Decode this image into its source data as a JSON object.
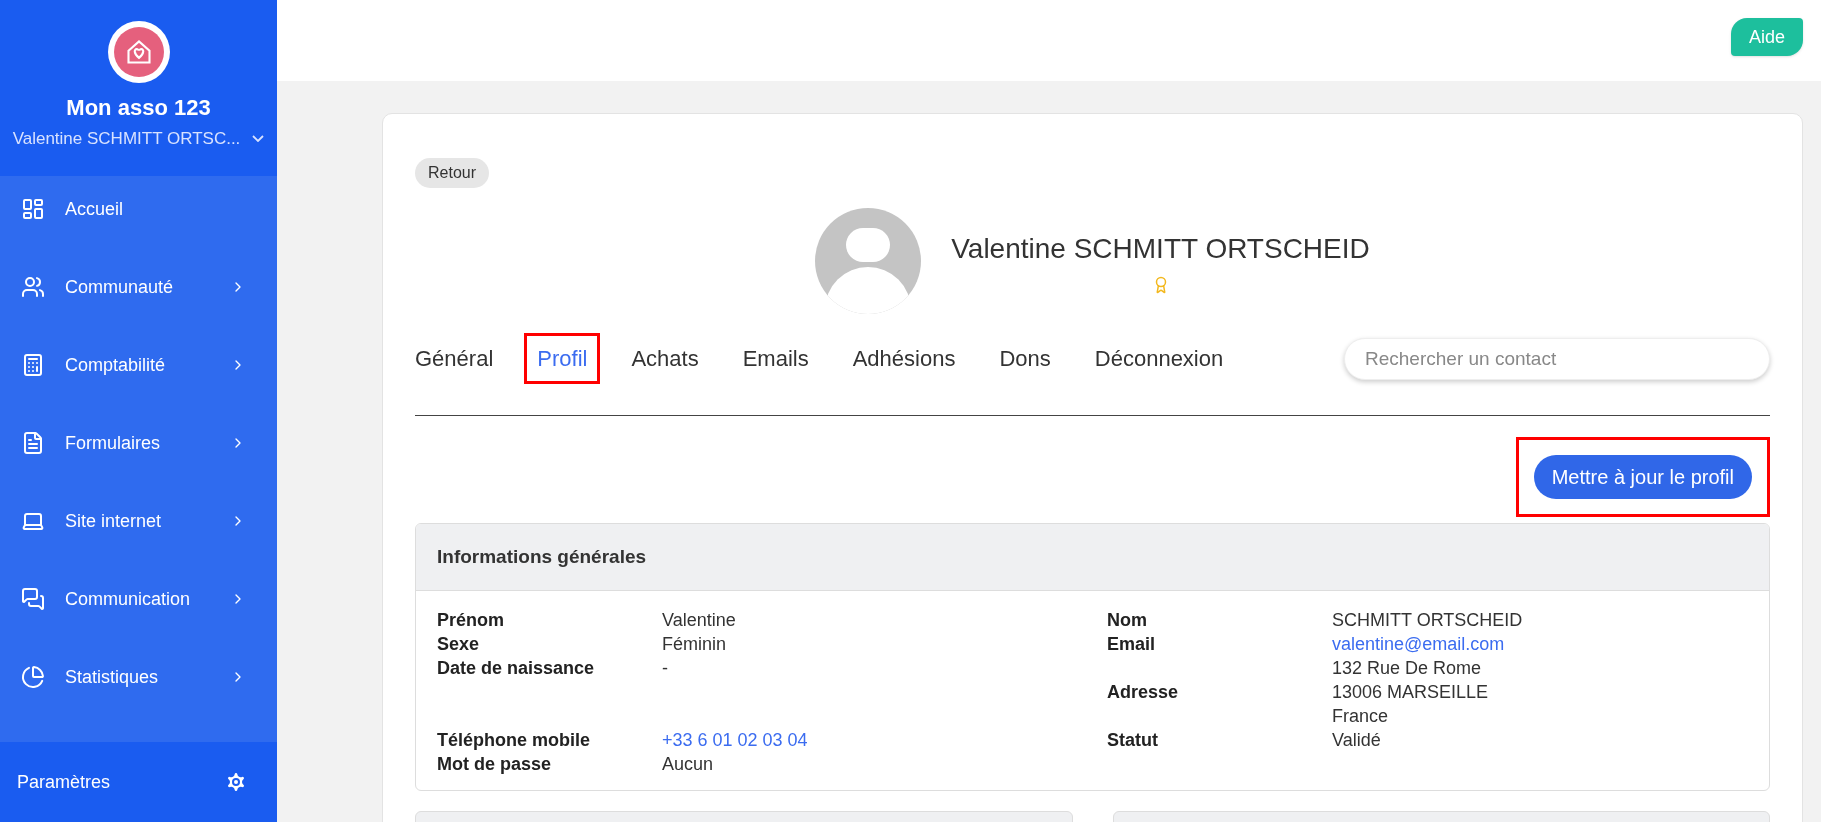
{
  "sidebar": {
    "org_name": "Mon asso 123",
    "user_name": "Valentine SCHMITT ORTSC...",
    "items": [
      {
        "label": "Accueil",
        "has_submenu": false
      },
      {
        "label": "Communauté",
        "has_submenu": true
      },
      {
        "label": "Comptabilité",
        "has_submenu": true
      },
      {
        "label": "Formulaires",
        "has_submenu": true
      },
      {
        "label": "Site internet",
        "has_submenu": true
      },
      {
        "label": "Communication",
        "has_submenu": true
      },
      {
        "label": "Statistiques",
        "has_submenu": true
      }
    ],
    "settings_label": "Paramètres"
  },
  "help_button": "Aide",
  "back_button": "Retour",
  "contact": {
    "name": "Valentine SCHMITT ORTSCHEID"
  },
  "tabs": [
    {
      "label": "Général",
      "selected": false,
      "highlighted": false
    },
    {
      "label": "Profil",
      "selected": true,
      "highlighted": true
    },
    {
      "label": "Achats",
      "selected": false,
      "highlighted": false
    },
    {
      "label": "Emails",
      "selected": false,
      "highlighted": false
    },
    {
      "label": "Adhésions",
      "selected": false,
      "highlighted": false
    },
    {
      "label": "Dons",
      "selected": false,
      "highlighted": false
    },
    {
      "label": "Déconnexion",
      "selected": false,
      "highlighted": false
    }
  ],
  "search": {
    "placeholder": "Rechercher un contact"
  },
  "update_button": {
    "label": "Mettre à jour le profil",
    "highlighted": true
  },
  "general_info": {
    "title": "Informations générales",
    "rows": [
      [
        {
          "label": "Prénom",
          "lines": [
            "Valentine"
          ],
          "link": false
        },
        {
          "label": "Nom",
          "lines": [
            "SCHMITT ORTSCHEID"
          ],
          "link": false
        }
      ],
      [
        {
          "label": "Sexe",
          "lines": [
            "Féminin"
          ],
          "link": false
        },
        {
          "label": "Email",
          "lines": [
            "valentine@email.com"
          ],
          "link": true
        }
      ],
      [
        {
          "label": "Date de naissance",
          "lines": [
            "-"
          ],
          "link": false
        },
        {
          "label": "Adresse",
          "lines": [
            "132 Rue De Rome",
            "13006 MARSEILLE",
            "France"
          ],
          "link": false
        }
      ],
      [
        {
          "label": "Téléphone mobile",
          "lines": [
            "+33 6 01 02 03 04"
          ],
          "link": true
        },
        {
          "label": "Statut",
          "lines": [
            "Validé"
          ],
          "link": false
        }
      ],
      [
        {
          "label": "Mot de passe",
          "lines": [
            "Aucun"
          ],
          "link": false
        }
      ]
    ]
  }
}
